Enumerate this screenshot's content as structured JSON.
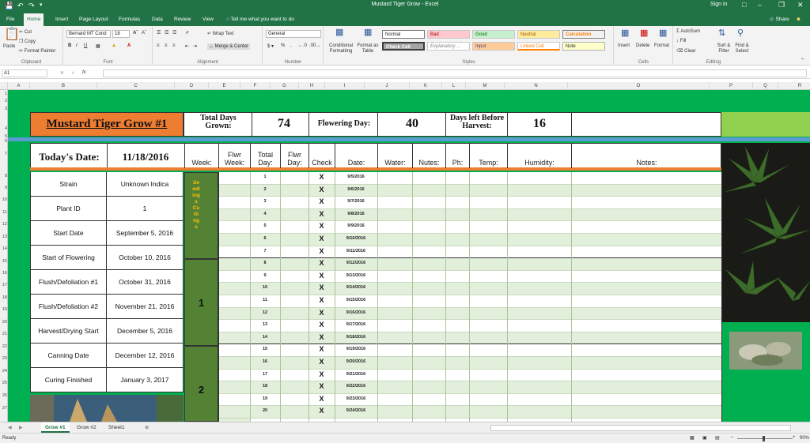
{
  "window": {
    "title": "Mustard Tiger Grow - Excel",
    "sign_in": "Sign in"
  },
  "ribbon": {
    "tabs": [
      "File",
      "Home",
      "Insert",
      "Page Layout",
      "Formulas",
      "Data",
      "Review",
      "View"
    ],
    "tell_me": "Tell me what you want to do",
    "share": "Share",
    "clipboard": {
      "paste": "Paste",
      "cut": "Cut",
      "copy": "Copy",
      "format_painter": "Format Painter",
      "label": "Clipboard"
    },
    "font": {
      "name": "Bernard MT Cond",
      "size": "18",
      "label": "Font"
    },
    "alignment": {
      "wrap_text": "Wrap Text",
      "merge_center": "Merge & Center",
      "label": "Alignment"
    },
    "number": {
      "format": "General",
      "label": "Number"
    },
    "styles": {
      "conditional": "Conditional Formatting",
      "format_table": "Format as Table",
      "cells": [
        "Normal",
        "Bad",
        "Good",
        "Neutral",
        "Calculation",
        "Check Cell",
        "Explanatory ...",
        "Input",
        "Linked Cell",
        "Note"
      ],
      "label": "Styles"
    },
    "cells_group": {
      "insert": "Insert",
      "delete": "Delete",
      "format": "Format",
      "label": "Cells"
    },
    "editing": {
      "autosum": "AutoSum",
      "fill": "Fill",
      "clear": "Clear",
      "sort": "Sort & Filter",
      "find": "Find & Select",
      "label": "Editing"
    }
  },
  "formula_bar": {
    "name_box": "A1",
    "fx": "fx",
    "value": ""
  },
  "columns": [
    "A",
    "B",
    "C",
    "D",
    "E",
    "F",
    "G",
    "H",
    "I",
    "J",
    "K",
    "L",
    "M",
    "N",
    "O",
    "P",
    "Q",
    "R"
  ],
  "rows": [
    "1",
    "2",
    "3",
    "4",
    "5",
    "6",
    "7",
    "8",
    "9",
    "10",
    "11",
    "12",
    "13",
    "14",
    "15",
    "16",
    "17",
    "18",
    "19",
    "20",
    "21",
    "22",
    "23",
    "24",
    "25",
    "26",
    "27"
  ],
  "sheet": {
    "title": "Mustard Tiger Grow #1",
    "total_days_label": "Total Days Grown:",
    "total_days": "74",
    "flowering_day_label": "Flowering Day:",
    "flowering_day": "40",
    "days_left_label": "Days left Before Harvest:",
    "days_left": "16",
    "todays_date_label": "Today's Date:",
    "todays_date": "11/18/2016",
    "headers": {
      "week": "Week:",
      "flwr_week": "Flwr Week:",
      "total_day": "Total Day:",
      "flwr_day": "Flwr Day:",
      "check": "Check",
      "date": "Date:",
      "water": "Water:",
      "nutes": "Nutes:",
      "ph": "Ph:",
      "temp": "Temp:",
      "humidity": "Humidity:",
      "notes": "Notes:"
    },
    "info": [
      {
        "label": "Strain",
        "value": "Unknown Indica"
      },
      {
        "label": "Plant ID",
        "value": "1"
      },
      {
        "label": "Start Date",
        "value": "September 5, 2016"
      },
      {
        "label": "Start of Flowering",
        "value": "October 10, 2016"
      },
      {
        "label": "Flush/Defoliation #1",
        "value": "October 31, 2016"
      },
      {
        "label": "Flush/Defoliation #2",
        "value": "November 21, 2016"
      },
      {
        "label": "Harvest/Drying Start",
        "value": "December 5, 2016"
      },
      {
        "label": "Canning Date",
        "value": "December 12, 2016"
      },
      {
        "label": "Curing Finished",
        "value": "January 3, 2017"
      }
    ],
    "weeks": [
      {
        "label": "Seedlings Cuttings"
      },
      {
        "label": "1"
      },
      {
        "label": "2"
      }
    ],
    "days": [
      {
        "day": "1",
        "check": "X",
        "date": "9/5/2016"
      },
      {
        "day": "2",
        "check": "X",
        "date": "9/6/2016"
      },
      {
        "day": "3",
        "check": "X",
        "date": "9/7/2016"
      },
      {
        "day": "4",
        "check": "X",
        "date": "9/8/2016"
      },
      {
        "day": "5",
        "check": "X",
        "date": "9/9/2016"
      },
      {
        "day": "6",
        "check": "X",
        "date": "9/10/2016"
      },
      {
        "day": "7",
        "check": "X",
        "date": "9/11/2016"
      },
      {
        "day": "8",
        "check": "X",
        "date": "9/12/2016"
      },
      {
        "day": "9",
        "check": "X",
        "date": "9/13/2016"
      },
      {
        "day": "10",
        "check": "X",
        "date": "9/14/2016"
      },
      {
        "day": "11",
        "check": "X",
        "date": "9/15/2016"
      },
      {
        "day": "12",
        "check": "X",
        "date": "9/16/2016"
      },
      {
        "day": "13",
        "check": "X",
        "date": "9/17/2016"
      },
      {
        "day": "14",
        "check": "X",
        "date": "9/18/2016"
      },
      {
        "day": "15",
        "check": "X",
        "date": "9/19/2016"
      },
      {
        "day": "16",
        "check": "X",
        "date": "9/20/2016"
      },
      {
        "day": "17",
        "check": "X",
        "date": "9/21/2016"
      },
      {
        "day": "18",
        "check": "X",
        "date": "9/22/2016"
      },
      {
        "day": "19",
        "check": "X",
        "date": "9/23/2016"
      },
      {
        "day": "20",
        "check": "X",
        "date": "9/24/2016"
      }
    ]
  },
  "sheet_tabs": [
    "Grow #1",
    "Grow #2",
    "Sheet1"
  ],
  "status": {
    "ready": "Ready",
    "zoom": "90%"
  },
  "colors": {
    "excel_green": "#217346",
    "sheet_green": "#00b050",
    "orange": "#ed7d31",
    "week_green": "#548235",
    "stripe": "#e2efda"
  }
}
